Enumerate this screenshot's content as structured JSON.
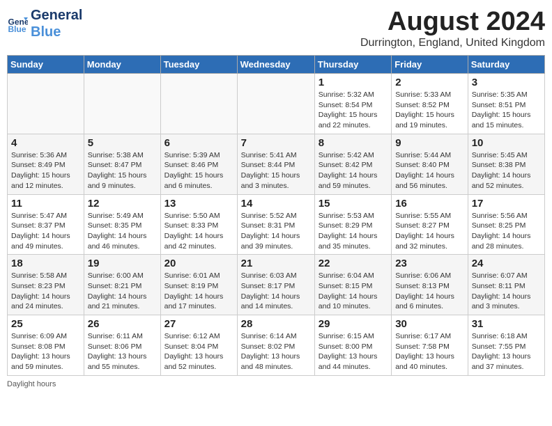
{
  "header": {
    "logo_line1": "General",
    "logo_line2": "Blue",
    "month_year": "August 2024",
    "location": "Durrington, England, United Kingdom"
  },
  "weekdays": [
    "Sunday",
    "Monday",
    "Tuesday",
    "Wednesday",
    "Thursday",
    "Friday",
    "Saturday"
  ],
  "weeks": [
    [
      {
        "day": "",
        "info": ""
      },
      {
        "day": "",
        "info": ""
      },
      {
        "day": "",
        "info": ""
      },
      {
        "day": "",
        "info": ""
      },
      {
        "day": "1",
        "info": "Sunrise: 5:32 AM\nSunset: 8:54 PM\nDaylight: 15 hours\nand 22 minutes."
      },
      {
        "day": "2",
        "info": "Sunrise: 5:33 AM\nSunset: 8:52 PM\nDaylight: 15 hours\nand 19 minutes."
      },
      {
        "day": "3",
        "info": "Sunrise: 5:35 AM\nSunset: 8:51 PM\nDaylight: 15 hours\nand 15 minutes."
      }
    ],
    [
      {
        "day": "4",
        "info": "Sunrise: 5:36 AM\nSunset: 8:49 PM\nDaylight: 15 hours\nand 12 minutes."
      },
      {
        "day": "5",
        "info": "Sunrise: 5:38 AM\nSunset: 8:47 PM\nDaylight: 15 hours\nand 9 minutes."
      },
      {
        "day": "6",
        "info": "Sunrise: 5:39 AM\nSunset: 8:46 PM\nDaylight: 15 hours\nand 6 minutes."
      },
      {
        "day": "7",
        "info": "Sunrise: 5:41 AM\nSunset: 8:44 PM\nDaylight: 15 hours\nand 3 minutes."
      },
      {
        "day": "8",
        "info": "Sunrise: 5:42 AM\nSunset: 8:42 PM\nDaylight: 14 hours\nand 59 minutes."
      },
      {
        "day": "9",
        "info": "Sunrise: 5:44 AM\nSunset: 8:40 PM\nDaylight: 14 hours\nand 56 minutes."
      },
      {
        "day": "10",
        "info": "Sunrise: 5:45 AM\nSunset: 8:38 PM\nDaylight: 14 hours\nand 52 minutes."
      }
    ],
    [
      {
        "day": "11",
        "info": "Sunrise: 5:47 AM\nSunset: 8:37 PM\nDaylight: 14 hours\nand 49 minutes."
      },
      {
        "day": "12",
        "info": "Sunrise: 5:49 AM\nSunset: 8:35 PM\nDaylight: 14 hours\nand 46 minutes."
      },
      {
        "day": "13",
        "info": "Sunrise: 5:50 AM\nSunset: 8:33 PM\nDaylight: 14 hours\nand 42 minutes."
      },
      {
        "day": "14",
        "info": "Sunrise: 5:52 AM\nSunset: 8:31 PM\nDaylight: 14 hours\nand 39 minutes."
      },
      {
        "day": "15",
        "info": "Sunrise: 5:53 AM\nSunset: 8:29 PM\nDaylight: 14 hours\nand 35 minutes."
      },
      {
        "day": "16",
        "info": "Sunrise: 5:55 AM\nSunset: 8:27 PM\nDaylight: 14 hours\nand 32 minutes."
      },
      {
        "day": "17",
        "info": "Sunrise: 5:56 AM\nSunset: 8:25 PM\nDaylight: 14 hours\nand 28 minutes."
      }
    ],
    [
      {
        "day": "18",
        "info": "Sunrise: 5:58 AM\nSunset: 8:23 PM\nDaylight: 14 hours\nand 24 minutes."
      },
      {
        "day": "19",
        "info": "Sunrise: 6:00 AM\nSunset: 8:21 PM\nDaylight: 14 hours\nand 21 minutes."
      },
      {
        "day": "20",
        "info": "Sunrise: 6:01 AM\nSunset: 8:19 PM\nDaylight: 14 hours\nand 17 minutes."
      },
      {
        "day": "21",
        "info": "Sunrise: 6:03 AM\nSunset: 8:17 PM\nDaylight: 14 hours\nand 14 minutes."
      },
      {
        "day": "22",
        "info": "Sunrise: 6:04 AM\nSunset: 8:15 PM\nDaylight: 14 hours\nand 10 minutes."
      },
      {
        "day": "23",
        "info": "Sunrise: 6:06 AM\nSunset: 8:13 PM\nDaylight: 14 hours\nand 6 minutes."
      },
      {
        "day": "24",
        "info": "Sunrise: 6:07 AM\nSunset: 8:11 PM\nDaylight: 14 hours\nand 3 minutes."
      }
    ],
    [
      {
        "day": "25",
        "info": "Sunrise: 6:09 AM\nSunset: 8:08 PM\nDaylight: 13 hours\nand 59 minutes."
      },
      {
        "day": "26",
        "info": "Sunrise: 6:11 AM\nSunset: 8:06 PM\nDaylight: 13 hours\nand 55 minutes."
      },
      {
        "day": "27",
        "info": "Sunrise: 6:12 AM\nSunset: 8:04 PM\nDaylight: 13 hours\nand 52 minutes."
      },
      {
        "day": "28",
        "info": "Sunrise: 6:14 AM\nSunset: 8:02 PM\nDaylight: 13 hours\nand 48 minutes."
      },
      {
        "day": "29",
        "info": "Sunrise: 6:15 AM\nSunset: 8:00 PM\nDaylight: 13 hours\nand 44 minutes."
      },
      {
        "day": "30",
        "info": "Sunrise: 6:17 AM\nSunset: 7:58 PM\nDaylight: 13 hours\nand 40 minutes."
      },
      {
        "day": "31",
        "info": "Sunrise: 6:18 AM\nSunset: 7:55 PM\nDaylight: 13 hours\nand 37 minutes."
      }
    ]
  ],
  "footer": "Daylight hours"
}
